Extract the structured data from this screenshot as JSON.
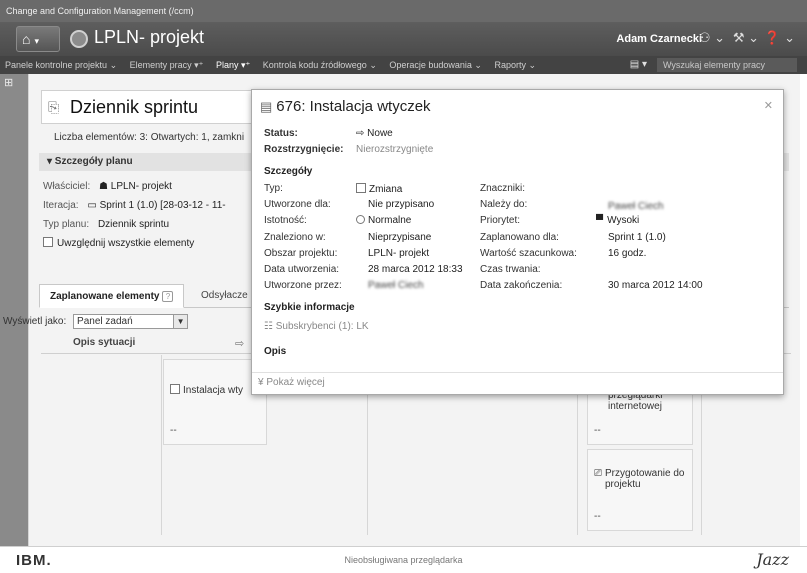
{
  "app": {
    "top_strip": "Change and Configuration Management (/ccm)",
    "project_title": "LPLN- projekt",
    "user": "Adam Czarnecki"
  },
  "menu": {
    "items": [
      {
        "label": "Panele kontrolne projektu ⌄",
        "active": false
      },
      {
        "label": "Elementy pracy ▾⁺",
        "active": false
      },
      {
        "label": "Plany ▾⁺",
        "active": true
      },
      {
        "label": "Kontrola kodu źródłowego ⌄",
        "active": false
      },
      {
        "label": "Operacje budowania ⌄",
        "active": false
      },
      {
        "label": "Raporty ⌄",
        "active": false
      }
    ],
    "search_placeholder": "Wyszukaj elementy pracy"
  },
  "sprint": {
    "title": "Dziennik sprintu",
    "counts": "Liczba elementów: 3:  Otwartych: 1, zamkni",
    "section_title": "▾ Szczegóły planu",
    "owner_label": "Właściciel:",
    "owner_value": "LPLN- projekt",
    "iteration_label": "Iteracja:",
    "iteration_value": "Sprint 1 (1.0) [28-03-12 - 11-",
    "plan_type_label": "Typ planu:",
    "plan_type_value": "Dziennik sprintu",
    "include_all": "Uwzględnij wszystkie elementy"
  },
  "tabs": {
    "planned": "Zaplanowane elementy",
    "other": "Odsyłacze"
  },
  "view": {
    "label": "Wyświetl jako:",
    "selected": "Panel zadań"
  },
  "board": {
    "col_situation": "Opis sytuacji",
    "card1_title": "Instalacja wty",
    "card1_dash": "--",
    "card2_title": "przeglądarki internetowej",
    "card2_dash": "--",
    "card3_title": "Przygotowanie do projektu",
    "card3_dash": "--"
  },
  "popup": {
    "title": "676: Instalacja wtyczek",
    "status_label": "Status:",
    "status_value": "⇨ Nowe",
    "resolution_label": "Rozstrzygnięcie:",
    "resolution_value": "Nierozstrzygnięte",
    "details_title": "Szczegóły",
    "type_label": "Typ:",
    "type_value": "Zmiana",
    "created_for_label": "Utworzone dla:",
    "created_for_value": "Nie przypisano",
    "severity_label": "Istotność:",
    "severity_value": "Normalne",
    "found_in_label": "Znaleziono w:",
    "found_in_value": "Nieprzypisane",
    "area_label": "Obszar projektu:",
    "area_value": "LPLN- projekt",
    "created_date_label": "Data utworzenia:",
    "created_date_value": "28 marca 2012 18:33",
    "created_by_label": "Utworzone przez:",
    "created_by_value": "Paweł Ciech",
    "tags_label": "Znaczniki:",
    "owner_label": "Należy do:",
    "owner_value": "Paweł Ciech",
    "priority_label": "Priorytet:",
    "priority_value": "Wysoki",
    "planned_for_label": "Zaplanowano dla:",
    "planned_for_value": "Sprint 1 (1.0)",
    "estimate_label": "Wartość szacunkowa:",
    "estimate_value": "16 godz.",
    "duration_label": "Czas trwania:",
    "end_date_label": "Data zakończenia:",
    "end_date_value": "30 marca 2012 14:00",
    "quick_info_title": "Szybkie informacje",
    "subscribers": "Subskrybenci (1): LK",
    "description_title": "Opis",
    "show_more": "Pokaż więcej"
  },
  "footer": {
    "ibm": "IBM.",
    "unsupported": "Nieobsługiwana przeglądarka",
    "jazz": "Jazz"
  }
}
